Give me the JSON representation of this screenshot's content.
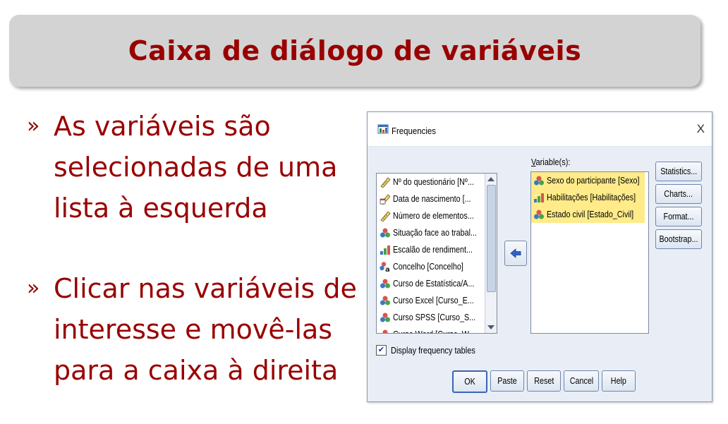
{
  "slide": {
    "title": "Caixa de diálogo de variáveis",
    "bullets": [
      {
        "mark": "»",
        "text": "As variáveis são selecionadas de uma lista à esquerda"
      },
      {
        "mark": "»",
        "text": "Clicar nas variáveis de interesse e movê-las para a caixa à direita"
      }
    ]
  },
  "dialog": {
    "title": "Frequencies",
    "close": "X",
    "source_items": [
      {
        "label": "Nº do questionário [Nº...",
        "icon": "scale-ruler-icon"
      },
      {
        "label": "Data de nascimento [...",
        "icon": "date-ruler-icon"
      },
      {
        "label": "Número de elementos...",
        "icon": "scale-ruler-icon"
      },
      {
        "label": "Situação face ao trabal...",
        "icon": "nominal-icon"
      },
      {
        "label": "Escalão de rendiment...",
        "icon": "ordinal-bars-icon"
      },
      {
        "label": "Concelho [Concelho]",
        "icon": "nominal-string-icon"
      },
      {
        "label": "Curso de Estatística/A...",
        "icon": "nominal-icon"
      },
      {
        "label": "Curso Excel [Curso_E...",
        "icon": "nominal-icon"
      },
      {
        "label": "Curso SPSS [Curso_S...",
        "icon": "nominal-icon"
      },
      {
        "label": "Curso Word [Curso_W...",
        "icon": "nominal-icon"
      }
    ],
    "variables_label_u": "V",
    "variables_label_rest": "ariable(s):",
    "target_items": [
      {
        "label": "Sexo do participante [Sexo]",
        "icon": "nominal-icon"
      },
      {
        "label": "Habilitações [Habilitações]",
        "icon": "ordinal-bars-icon"
      },
      {
        "label": "Estado civil [Estado_Civil]",
        "icon": "nominal-icon"
      }
    ],
    "side_buttons": [
      "Statistics...",
      "Charts...",
      "Format...",
      "Bootstrap..."
    ],
    "checkbox": {
      "label": "Display frequency tables",
      "checked": "✔"
    },
    "bottom_buttons": [
      "OK",
      "Paste",
      "Reset",
      "Cancel",
      "Help"
    ],
    "colors": {
      "slide_text": "#990000",
      "highlight": "#ffeb8a"
    }
  }
}
